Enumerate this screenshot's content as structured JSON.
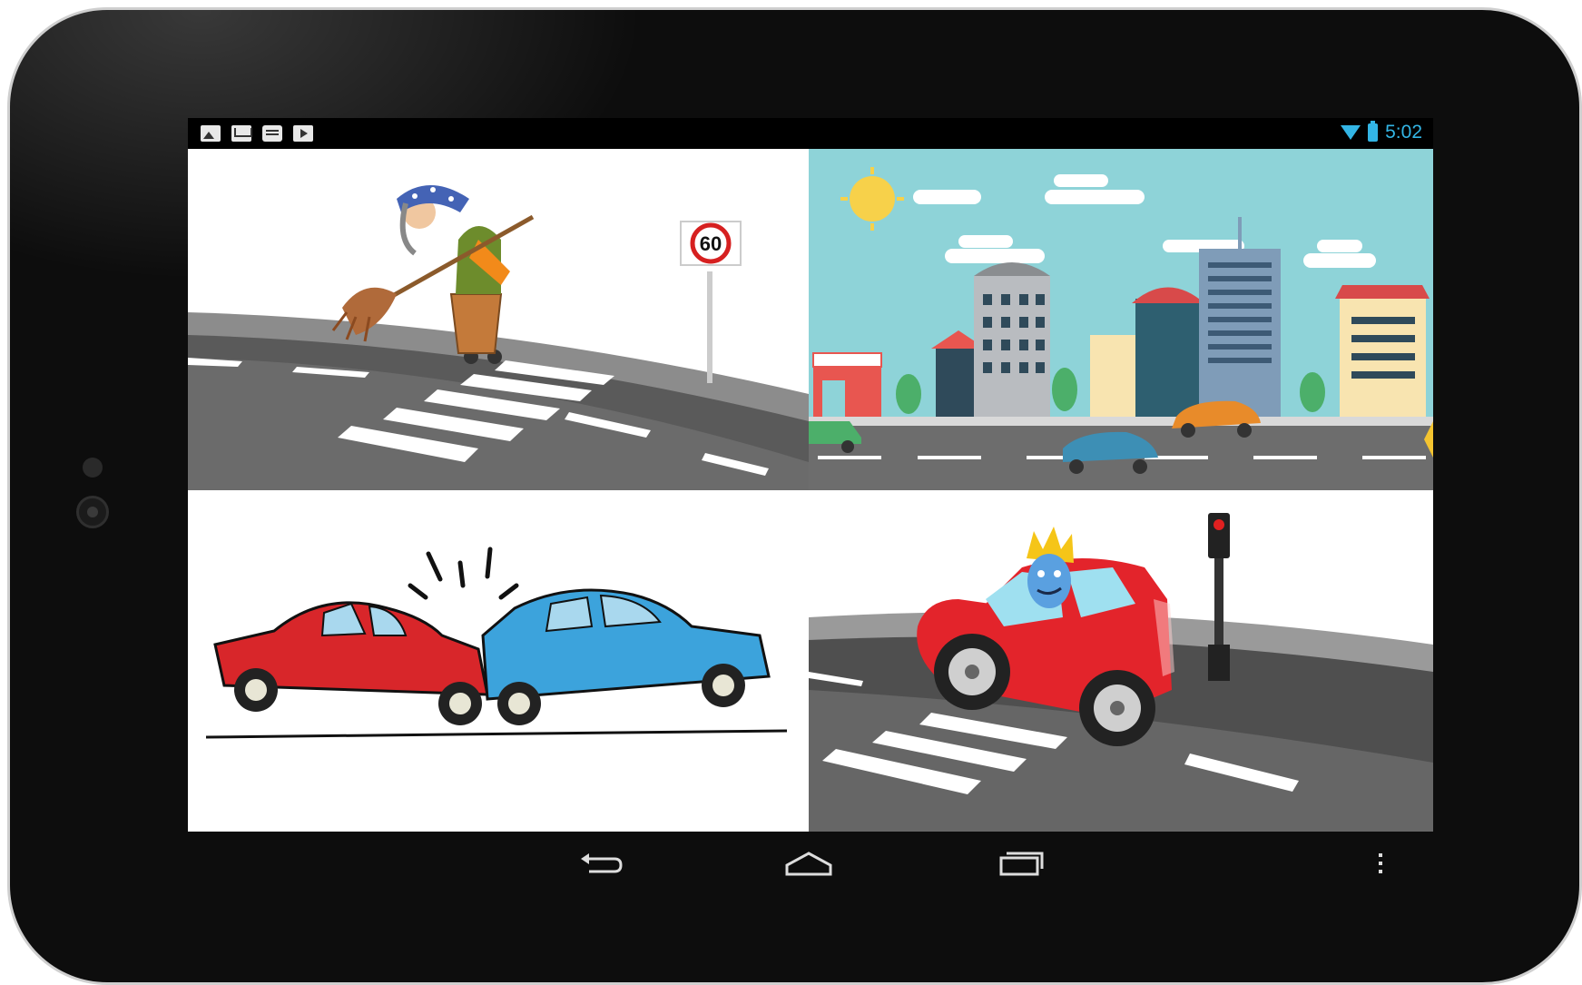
{
  "status_bar": {
    "notification_icons": [
      "gallery-icon",
      "gmail-icon",
      "chat-icon",
      "play-store-icon"
    ],
    "wifi_icon": "wifi-icon",
    "battery_icon": "battery-icon",
    "time": "5:02",
    "accent_color": "#33b5e5"
  },
  "panels": [
    {
      "id": "witch-crossing",
      "sign_text": "60"
    },
    {
      "id": "city-street"
    },
    {
      "id": "car-crash"
    },
    {
      "id": "king-red-car"
    }
  ],
  "navigation_bar": {
    "back_icon": "back-icon",
    "home_icon": "home-icon",
    "recents_icon": "recent-apps-icon",
    "menu_icon": "overflow-menu-icon"
  }
}
